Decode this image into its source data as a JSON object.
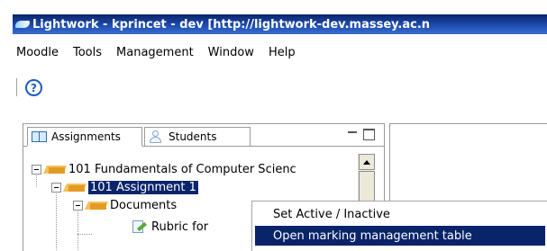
{
  "window": {
    "title": "Lightwork - kprincet - dev [http://lightwork-dev.massey.ac.n"
  },
  "menubar": {
    "items": [
      "Moodle",
      "Tools",
      "Management",
      "Window",
      "Help"
    ]
  },
  "toolbar": {
    "help_glyph": "?"
  },
  "view": {
    "tabs": [
      "Assignments",
      "Students"
    ]
  },
  "tree": {
    "course": "101 Fundamentals of Computer Scienc",
    "assignment": "101 Assignment 1",
    "folder": "Documents",
    "file": "Rubric for"
  },
  "context_menu": {
    "items": [
      "Set Active / Inactive",
      "Open marking management table"
    ],
    "highlighted_index": 1
  },
  "colors": {
    "selection": "#0a246a",
    "titlebar": "#1f50b4",
    "folder": "#e49b23"
  },
  "icons": [
    "app-icon",
    "help-icon",
    "assignments-book-icon",
    "students-icon",
    "minimize-icon",
    "maximize-icon",
    "folder-icon",
    "file-edit-icon",
    "scroll-up-icon"
  ]
}
